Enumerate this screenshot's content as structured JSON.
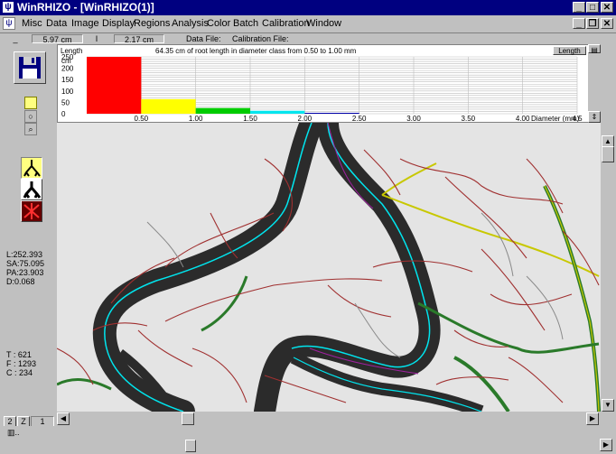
{
  "window": {
    "title": "WinRHIZO - [WinRHIZO(1)]",
    "app_icon": "tree-icon",
    "caption_buttons": [
      "_",
      "□",
      "✕"
    ],
    "mdi_buttons": [
      "_",
      "❐",
      "✕"
    ]
  },
  "menu": {
    "items": [
      "Misc",
      "Data",
      "Image",
      "Display",
      "Regions",
      "Analysis",
      "Color",
      "Batch",
      "Calibration",
      "Window"
    ]
  },
  "status": {
    "box1": "_",
    "x_value": "5.97 cm",
    "sep": "I",
    "y_value": "2.17 cm",
    "data_file_label": "Data File:",
    "calibration_file_label": "Calibration File:"
  },
  "chart_data": {
    "type": "bar",
    "title": "64.35 cm of root length in diameter class from 0.50 to 1.00 mm",
    "ylabel": "Length",
    "yunit": "cm",
    "xlabel": "Diameter (mm)",
    "ylim": [
      0,
      250
    ],
    "yticks": [
      "250",
      "200",
      "150",
      "100",
      "50",
      "0"
    ],
    "xticks": [
      "0.50",
      "1.00",
      "1.50",
      "2.00",
      "2.50",
      "3.00",
      "3.50",
      "4.00",
      "4.5"
    ],
    "categories": [
      "0.00-0.50",
      "0.50-1.00",
      "1.00-1.50",
      "1.50-2.00",
      "2.00-2.50"
    ],
    "values": [
      252,
      64,
      25,
      13,
      4
    ],
    "colors": [
      "#ff0000",
      "#ffff00",
      "#00cc00",
      "#00e5ee",
      "#0000aa"
    ],
    "xlim": [
      0,
      4.5
    ],
    "grid": true,
    "dropdown_label": "Length"
  },
  "stats": {
    "L": "L:252.393",
    "SA": "SA:75.095",
    "PA": "PA:23.903",
    "D": "D:0.068",
    "T": "T : 621",
    "F": "F : 1293",
    "C": "C : 234"
  },
  "bottom_buttons": {
    "b1": "2",
    "b2": "Z",
    "b3": "1"
  }
}
